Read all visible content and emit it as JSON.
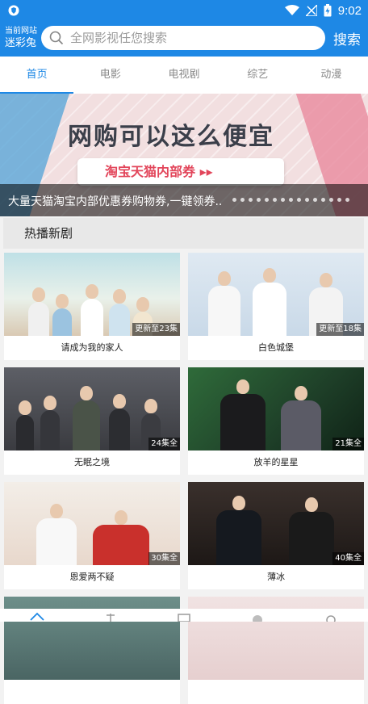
{
  "status_bar": {
    "time": "9:02",
    "icons": [
      "wifi-icon",
      "signal-icon",
      "battery-charging-icon"
    ]
  },
  "header": {
    "site_label": "当前网站",
    "site_name": "迷彩兔",
    "search_placeholder": "全网影视任您搜索",
    "search_button": "搜索"
  },
  "tabs": [
    {
      "label": "首页",
      "active": true
    },
    {
      "label": "电影",
      "active": false
    },
    {
      "label": "电视剧",
      "active": false
    },
    {
      "label": "综艺",
      "active": false
    },
    {
      "label": "动漫",
      "active": false
    }
  ],
  "banner": {
    "headline": "网购可以这么便宜",
    "sub": "淘宝天猫内部券 ▸▸",
    "caption": "大量天猫淘宝内部优惠券购物券,一键领券.."
  },
  "section": {
    "title": "热播新剧"
  },
  "shows": [
    {
      "title": "请成为我的家人",
      "badge": "更新至23集"
    },
    {
      "title": "白色城堡",
      "badge": "更新至18集"
    },
    {
      "title": "无眠之境",
      "badge": "24集全"
    },
    {
      "title": "放羊的星星",
      "badge": "21集全"
    },
    {
      "title": "恩爱两不疑",
      "badge": "30集全"
    },
    {
      "title": "薄冰",
      "badge": "40集全"
    },
    {
      "title": "",
      "badge": ""
    },
    {
      "title": "",
      "badge": ""
    }
  ],
  "bottom_nav": [
    "home-icon",
    "video-icon",
    "tv-icon",
    "discover-icon",
    "user-icon"
  ]
}
